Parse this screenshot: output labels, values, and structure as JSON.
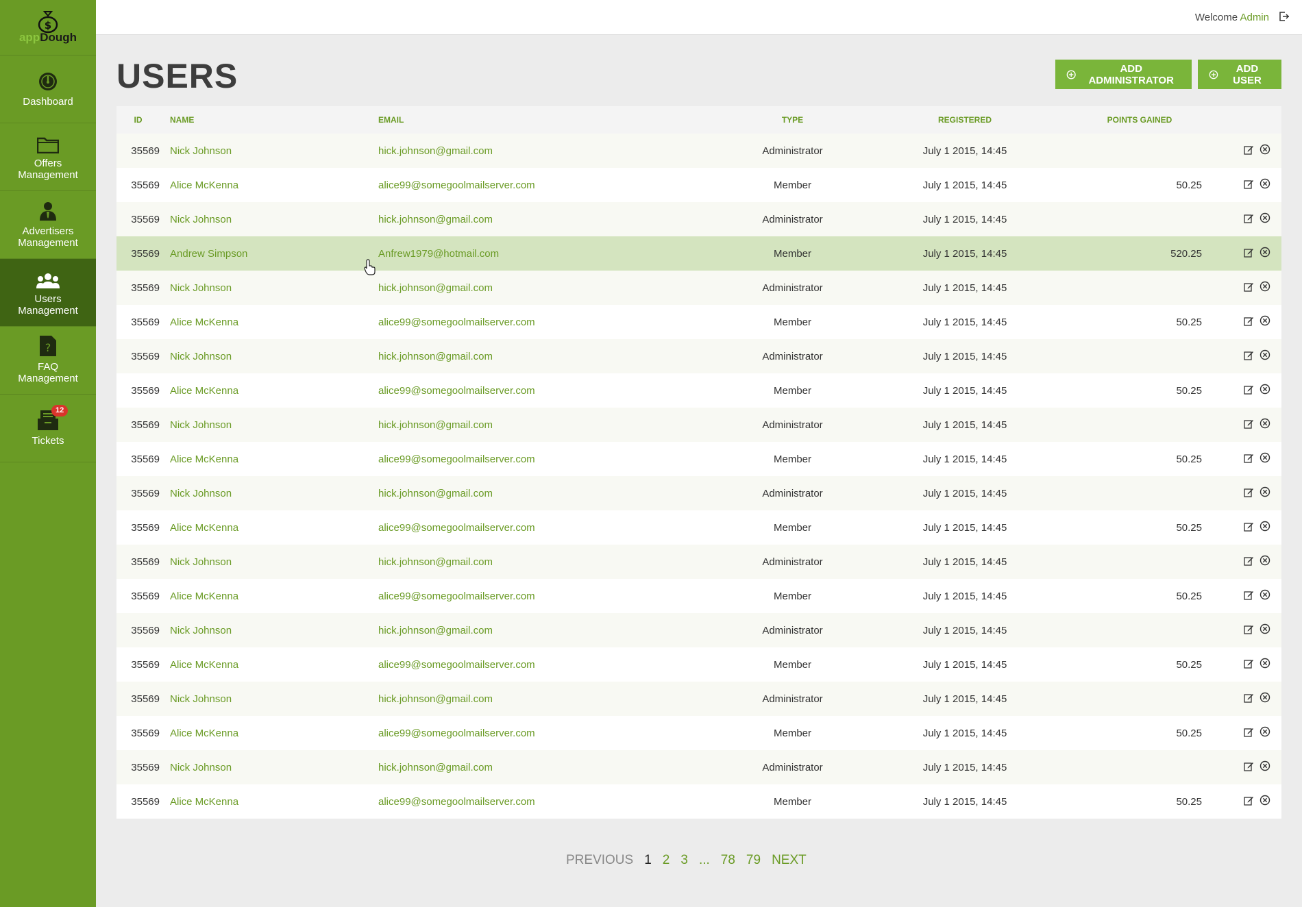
{
  "brand": {
    "logo_part1": "app",
    "logo_part2": "Dough"
  },
  "sidebar": {
    "items": [
      {
        "label": "Dashboard",
        "icon": "dashboard-icon"
      },
      {
        "label": "Offers Management",
        "icon": "folder-icon"
      },
      {
        "label": "Advertisers Management",
        "icon": "advertiser-icon"
      },
      {
        "label": "Users Management",
        "icon": "users-icon",
        "active": true
      },
      {
        "label": "FAQ Management",
        "icon": "faq-icon"
      },
      {
        "label": "Tickets",
        "icon": "tickets-icon",
        "badge": "12"
      }
    ]
  },
  "header": {
    "welcome": "Welcome",
    "user": "Admin"
  },
  "page": {
    "title": "USERS",
    "add_admin_label": "ADD ADMINISTRATOR",
    "add_user_label": "ADD USER"
  },
  "table": {
    "columns": [
      "ID",
      "NAME",
      "EMAIL",
      "TYPE",
      "REGISTERED",
      "POINTS GAINED"
    ],
    "rows": [
      {
        "id": "35569",
        "name": "Nick Johnson",
        "email": "hick.johnson@gmail.com",
        "type": "Administrator",
        "registered": "July 1 2015, 14:45",
        "points": ""
      },
      {
        "id": "35569",
        "name": "Alice McKenna",
        "email": "alice99@somegoolmailserver.com",
        "type": "Member",
        "registered": "July 1 2015, 14:45",
        "points": "50.25"
      },
      {
        "id": "35569",
        "name": "Nick Johnson",
        "email": "hick.johnson@gmail.com",
        "type": "Administrator",
        "registered": "July 1 2015, 14:45",
        "points": ""
      },
      {
        "id": "35569",
        "name": "Andrew Simpson",
        "email": "Anfrew1979@hotmail.com",
        "type": "Member",
        "registered": "July 1 2015, 14:45",
        "points": "520.25",
        "hover": true
      },
      {
        "id": "35569",
        "name": "Nick Johnson",
        "email": "hick.johnson@gmail.com",
        "type": "Administrator",
        "registered": "July 1 2015, 14:45",
        "points": ""
      },
      {
        "id": "35569",
        "name": "Alice McKenna",
        "email": "alice99@somegoolmailserver.com",
        "type": "Member",
        "registered": "July 1 2015, 14:45",
        "points": "50.25"
      },
      {
        "id": "35569",
        "name": "Nick Johnson",
        "email": "hick.johnson@gmail.com",
        "type": "Administrator",
        "registered": "July 1 2015, 14:45",
        "points": ""
      },
      {
        "id": "35569",
        "name": "Alice McKenna",
        "email": "alice99@somegoolmailserver.com",
        "type": "Member",
        "registered": "July 1 2015, 14:45",
        "points": "50.25"
      },
      {
        "id": "35569",
        "name": "Nick Johnson",
        "email": "hick.johnson@gmail.com",
        "type": "Administrator",
        "registered": "July 1 2015, 14:45",
        "points": ""
      },
      {
        "id": "35569",
        "name": "Alice McKenna",
        "email": "alice99@somegoolmailserver.com",
        "type": "Member",
        "registered": "July 1 2015, 14:45",
        "points": "50.25"
      },
      {
        "id": "35569",
        "name": "Nick Johnson",
        "email": "hick.johnson@gmail.com",
        "type": "Administrator",
        "registered": "July 1 2015, 14:45",
        "points": ""
      },
      {
        "id": "35569",
        "name": "Alice McKenna",
        "email": "alice99@somegoolmailserver.com",
        "type": "Member",
        "registered": "July 1 2015, 14:45",
        "points": "50.25"
      },
      {
        "id": "35569",
        "name": "Nick Johnson",
        "email": "hick.johnson@gmail.com",
        "type": "Administrator",
        "registered": "July 1 2015, 14:45",
        "points": ""
      },
      {
        "id": "35569",
        "name": "Alice McKenna",
        "email": "alice99@somegoolmailserver.com",
        "type": "Member",
        "registered": "July 1 2015, 14:45",
        "points": "50.25"
      },
      {
        "id": "35569",
        "name": "Nick Johnson",
        "email": "hick.johnson@gmail.com",
        "type": "Administrator",
        "registered": "July 1 2015, 14:45",
        "points": ""
      },
      {
        "id": "35569",
        "name": "Alice McKenna",
        "email": "alice99@somegoolmailserver.com",
        "type": "Member",
        "registered": "July 1 2015, 14:45",
        "points": "50.25"
      },
      {
        "id": "35569",
        "name": "Nick Johnson",
        "email": "hick.johnson@gmail.com",
        "type": "Administrator",
        "registered": "July 1 2015, 14:45",
        "points": ""
      },
      {
        "id": "35569",
        "name": "Alice McKenna",
        "email": "alice99@somegoolmailserver.com",
        "type": "Member",
        "registered": "July 1 2015, 14:45",
        "points": "50.25"
      },
      {
        "id": "35569",
        "name": "Nick Johnson",
        "email": "hick.johnson@gmail.com",
        "type": "Administrator",
        "registered": "July 1 2015, 14:45",
        "points": ""
      },
      {
        "id": "35569",
        "name": "Alice McKenna",
        "email": "alice99@somegoolmailserver.com",
        "type": "Member",
        "registered": "July 1 2015, 14:45",
        "points": "50.25"
      }
    ]
  },
  "pagination": {
    "previous": "PREVIOUS",
    "pages": [
      "1",
      "2",
      "3",
      "...",
      "78",
      "79"
    ],
    "current": "1",
    "next": "NEXT"
  },
  "colors": {
    "sidebar": "#6a9b25",
    "sidebar_active": "#3f6413",
    "accent": "#7ab53a",
    "link": "#6a9b25",
    "hover_row": "#d4e4bf",
    "badge": "#d9342b"
  }
}
